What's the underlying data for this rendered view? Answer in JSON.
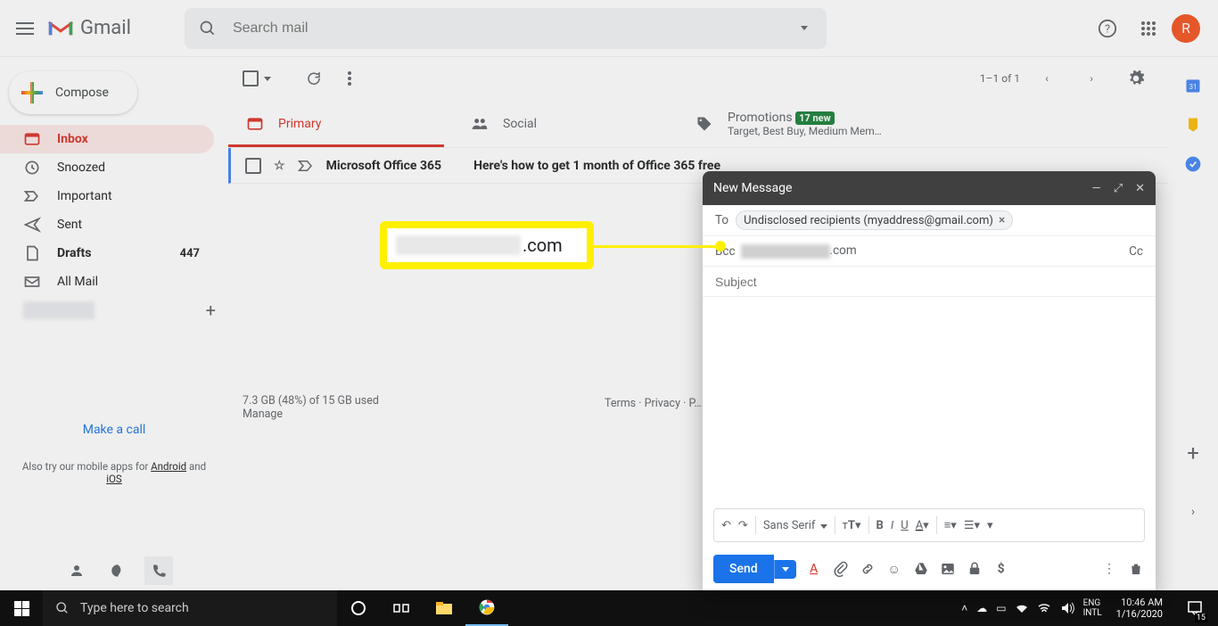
{
  "header": {
    "app_name": "Gmail",
    "search_placeholder": "Search mail",
    "avatar_letter": "R"
  },
  "sidebar": {
    "compose_label": "Compose",
    "items": [
      {
        "label": "Inbox",
        "count": ""
      },
      {
        "label": "Snoozed",
        "count": ""
      },
      {
        "label": "Important",
        "count": ""
      },
      {
        "label": "Sent",
        "count": ""
      },
      {
        "label": "Drafts",
        "count": "447"
      },
      {
        "label": "All Mail",
        "count": ""
      }
    ],
    "make_call": "Make a call",
    "mobile_text_pre": "Also try our mobile apps for ",
    "mobile_android": "Android",
    "mobile_and": " and ",
    "mobile_ios": "iOS"
  },
  "toolbar": {
    "range": "1–1 of 1"
  },
  "tabs": {
    "primary": "Primary",
    "social": "Social",
    "promotions": "Promotions",
    "promo_badge": "17 new",
    "promo_sub": "Target, Best Buy, Medium Mem…"
  },
  "emails": [
    {
      "sender": "Microsoft Office 365",
      "subject": "Here's how to get 1 month of Office 365 free"
    }
  ],
  "footer": {
    "storage": "7.3 GB (48%) of 15 GB used",
    "manage": "Manage",
    "terms": "Terms",
    "privacy": "Privacy",
    "sep": " · "
  },
  "compose_win": {
    "title": "New Message",
    "to_label": "To",
    "chip_text": "Undisclosed recipients (myaddress@gmail.com)",
    "bcc_label": "Bcc",
    "bcc_suffix": ".com",
    "cc_label": "Cc",
    "subject_placeholder": "Subject",
    "font": "Sans Serif",
    "send": "Send"
  },
  "callout": {
    "suffix": ".com"
  },
  "taskbar": {
    "search_placeholder": "Type here to search",
    "lang1": "ENG",
    "lang2": "INTL",
    "time": "10:46 AM",
    "date": "1/16/2020",
    "notif_count": "15"
  }
}
